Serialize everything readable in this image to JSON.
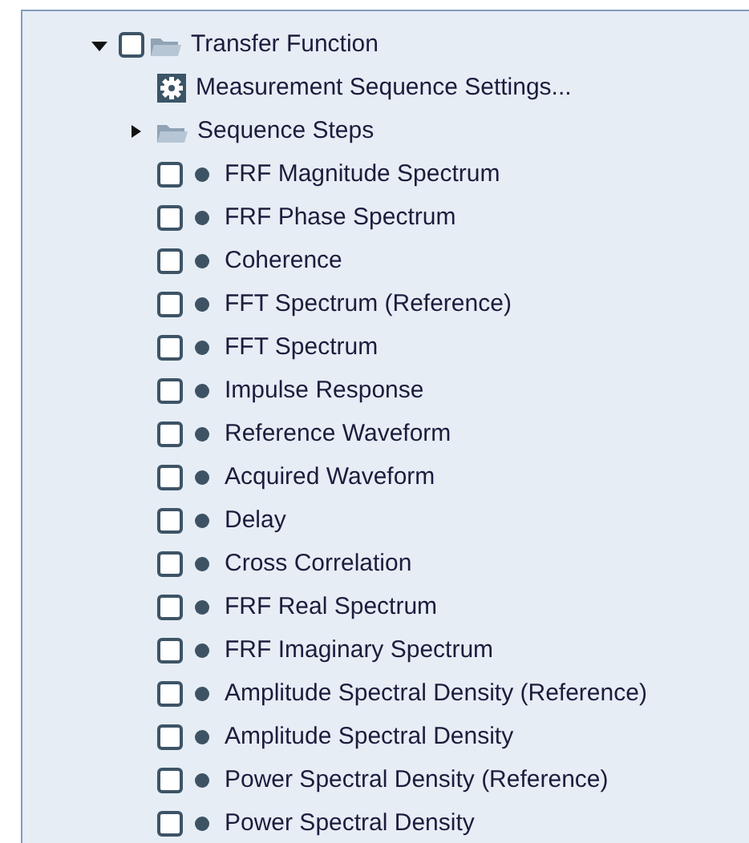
{
  "tree": [
    {
      "kind": "folder",
      "label": "Transfer Function",
      "expanded": true,
      "checked": false,
      "children": [
        {
          "kind": "settings",
          "label": "Measurement Sequence Settings..."
        },
        {
          "kind": "folder",
          "label": "Sequence Steps",
          "expanded": false
        },
        {
          "kind": "result",
          "label": "FRF Magnitude Spectrum",
          "checked": false
        },
        {
          "kind": "result",
          "label": "FRF Phase Spectrum",
          "checked": false
        },
        {
          "kind": "result",
          "label": "Coherence",
          "checked": false
        },
        {
          "kind": "result",
          "label": "FFT Spectrum (Reference)",
          "checked": false
        },
        {
          "kind": "result",
          "label": "FFT Spectrum",
          "checked": false
        },
        {
          "kind": "result",
          "label": "Impulse Response",
          "checked": false
        },
        {
          "kind": "result",
          "label": "Reference Waveform",
          "checked": false
        },
        {
          "kind": "result",
          "label": "Acquired Waveform",
          "checked": false
        },
        {
          "kind": "result",
          "label": "Delay",
          "checked": false
        },
        {
          "kind": "result",
          "label": "Cross Correlation",
          "checked": false
        },
        {
          "kind": "result",
          "label": "FRF Real Spectrum",
          "checked": false
        },
        {
          "kind": "result",
          "label": "FRF Imaginary Spectrum",
          "checked": false
        },
        {
          "kind": "result",
          "label": "Amplitude Spectral Density (Reference)",
          "checked": false
        },
        {
          "kind": "result",
          "label": "Amplitude Spectral Density",
          "checked": false
        },
        {
          "kind": "result",
          "label": "Power Spectral Density (Reference)",
          "checked": false
        },
        {
          "kind": "result",
          "label": "Power Spectral Density",
          "checked": false
        }
      ]
    }
  ]
}
